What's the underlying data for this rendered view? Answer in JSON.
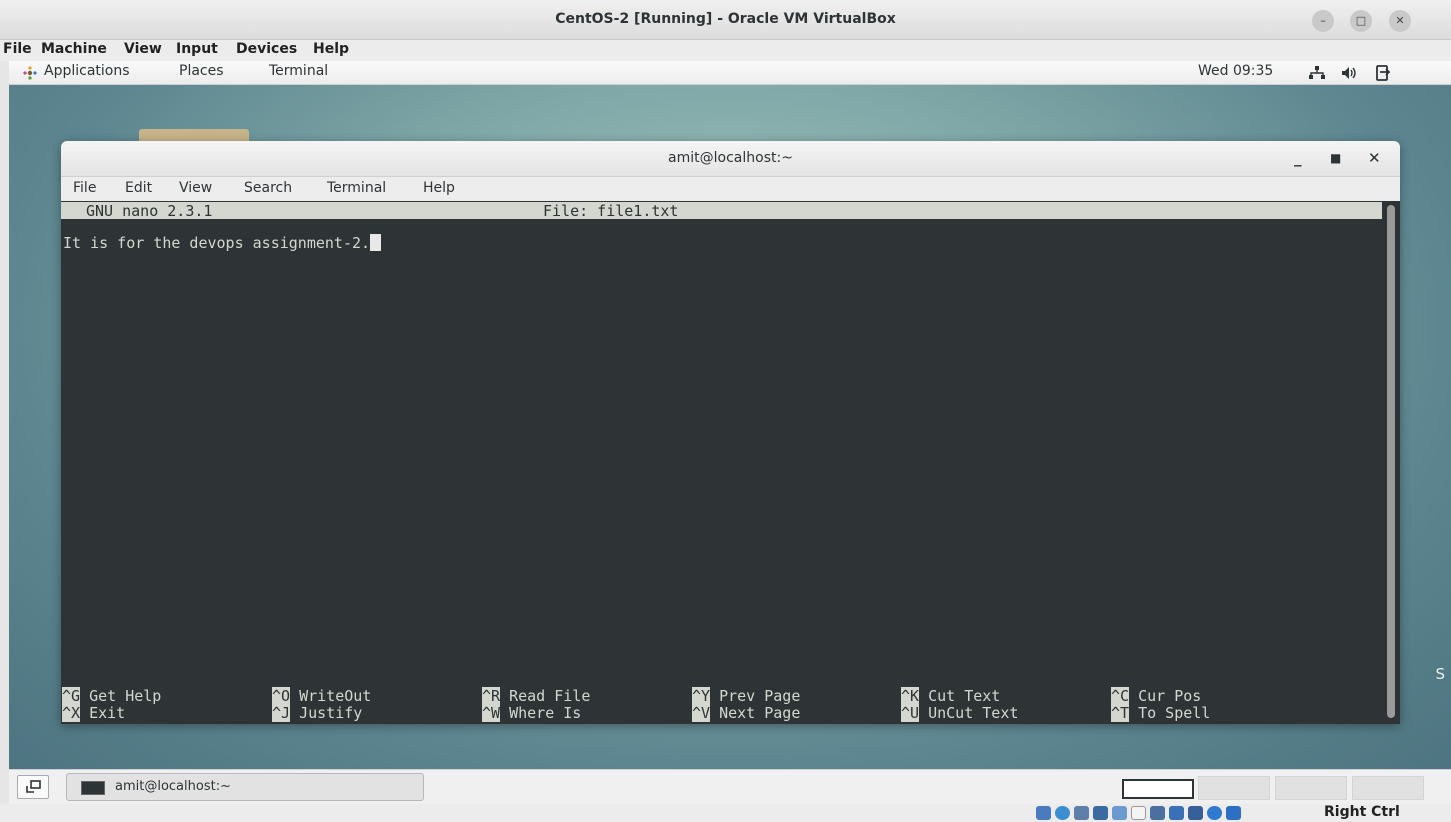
{
  "vbox": {
    "title": "CentOS-2 [Running] - Oracle VM VirtualBox",
    "menu": [
      "File",
      "Machine",
      "View",
      "Input",
      "Devices",
      "Help"
    ],
    "host_key": "Right Ctrl"
  },
  "gnome_panel": {
    "applications": "Applications",
    "places": "Places",
    "terminal": "Terminal",
    "clock": "Wed 09:35"
  },
  "desktop": {
    "watermark": "S"
  },
  "terminal": {
    "title": "amit@localhost:~",
    "menu": [
      "File",
      "Edit",
      "View",
      "Search",
      "Terminal",
      "Help"
    ]
  },
  "nano": {
    "version": "GNU nano 2.3.1",
    "file": "File: file1.txt",
    "content": "It is for the devops assignment-2.",
    "shortcuts_row1": [
      {
        "key": "^G",
        "label": "Get Help"
      },
      {
        "key": "^O",
        "label": "WriteOut"
      },
      {
        "key": "^R",
        "label": "Read File"
      },
      {
        "key": "^Y",
        "label": "Prev Page"
      },
      {
        "key": "^K",
        "label": "Cut Text"
      },
      {
        "key": "^C",
        "label": "Cur Pos"
      }
    ],
    "shortcuts_row2": [
      {
        "key": "^X",
        "label": "Exit"
      },
      {
        "key": "^J",
        "label": "Justify"
      },
      {
        "key": "^W",
        "label": "Where Is"
      },
      {
        "key": "^V",
        "label": "Next Page"
      },
      {
        "key": "^U",
        "label": "UnCut Text"
      },
      {
        "key": "^T",
        "label": "To Spell"
      }
    ]
  },
  "taskbar": {
    "task_label": "amit@localhost:~"
  },
  "colors": {
    "terminal_bg": "#2e3436",
    "terminal_fg": "#d3d7cf",
    "desktop_teal": "#7fa7a7"
  }
}
